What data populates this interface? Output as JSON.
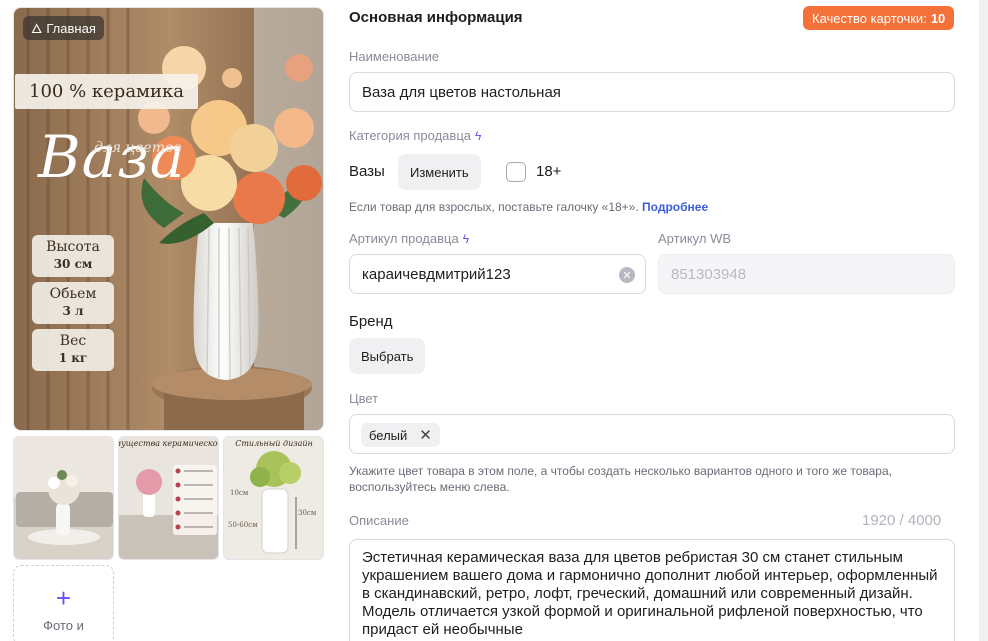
{
  "media": {
    "main_badge": "Главная",
    "ceramic_tag": "100 % керамика",
    "title_word": "Ваза",
    "title_sub": "для цветов",
    "specs": [
      {
        "label": "Высота",
        "value": "30 см"
      },
      {
        "label": "Обьем",
        "value": "3 л"
      },
      {
        "label": "Вес",
        "value": "1 кг"
      }
    ],
    "add_photo_label": "Фото и",
    "thumb2_title": "Преимущества керамической вазы",
    "thumb3_title": "Стильный дизайн",
    "thumb3_dims": [
      "30см",
      "10см",
      "50-60см"
    ]
  },
  "form": {
    "section_title": "Основная информация",
    "quality_label": "Качество карточки:",
    "quality_value": "10",
    "name_label": "Наименование",
    "name_value": "Ваза для цветов настольная",
    "category_label": "Категория продавца",
    "category_value": "Вазы",
    "change_button": "Изменить",
    "adult_label": "18+",
    "adult_hint": "Если товар для взрослых, поставьте галочку «18+».",
    "adult_link": "Подробнее",
    "article_label": "Артикул продавца",
    "article_value": "караичевдмитрий123",
    "wb_label": "Артикул WB",
    "wb_value": "851303948",
    "brand_label": "Бренд",
    "brand_button": "Выбрать",
    "color_label": "Цвет",
    "color_chip": "белый",
    "color_hint": "Укажите цвет товара в этом поле, а чтобы создать несколько вариантов одного и того же товара, воспользуйтесь меню слева.",
    "description_label": "Описание",
    "description_counter": "1920 / 4000",
    "description_value": "Эстетичная керамическая ваза для цветов ребристая 30 см станет стильным украшением вашего дома и гармонично дополнит любой интерьер, оформленный в скандинавский, ретро, лофт, греческий, домашний или современный дизайн. Модель отличается узкой формой и оригинальной рифленой поверхностью, что придаст ей необычные"
  },
  "colors": {
    "accent": "#6c4ff5",
    "quality_badge": "#f4723a",
    "link": "#3d5fd6"
  }
}
